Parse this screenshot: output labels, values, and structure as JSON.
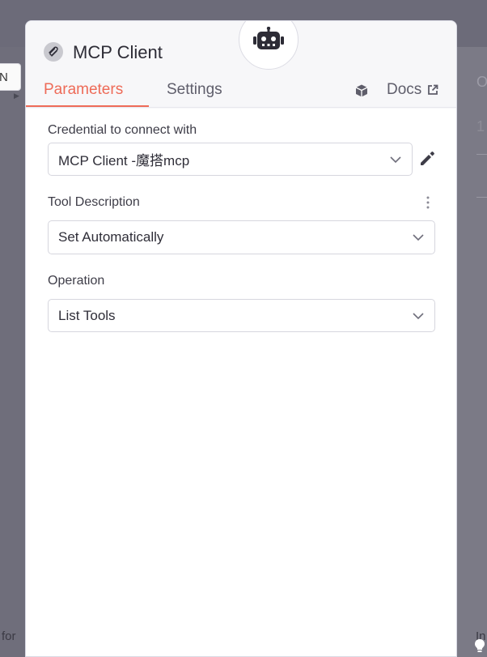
{
  "background": {
    "left_tab_text": "N",
    "right_letter": "O",
    "right_digit": "1",
    "bottom_left_text": "for",
    "bottom_right_text": "In"
  },
  "panel": {
    "title": "MCP Client",
    "tabs": [
      {
        "label": "Parameters",
        "active": true
      },
      {
        "label": "Settings",
        "active": false
      }
    ],
    "docs_label": "Docs",
    "accent_color": "#ee6b58"
  },
  "fields": {
    "credential": {
      "label": "Credential to connect with",
      "value": "MCP Client  -魔搭mcp"
    },
    "tool_description": {
      "label": "Tool Description",
      "value": "Set Automatically"
    },
    "operation": {
      "label": "Operation",
      "value": "List Tools"
    }
  }
}
